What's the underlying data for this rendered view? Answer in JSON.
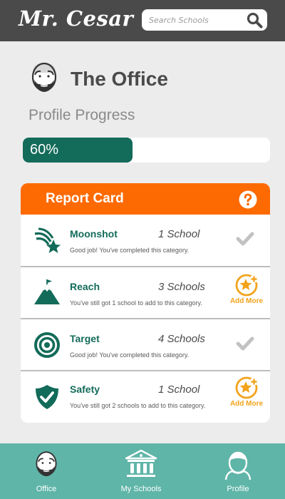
{
  "header": {
    "logo": "Mr. Cesar",
    "search_placeholder": "Search Schools",
    "search_value": ""
  },
  "profile": {
    "name": "The Office",
    "progress_label": "Profile Progress",
    "progress_percent": 60,
    "progress_text": "60%"
  },
  "report_card": {
    "title": "Report Card",
    "help_icon": "question-circle-icon",
    "rows": [
      {
        "title": "Moonshot",
        "count": "1 School",
        "description": "Good job! You've completed this category.",
        "icon": "shooting-star-icon",
        "status": "complete"
      },
      {
        "title": "Reach",
        "count": "3 Schools",
        "description": "You've still got 1 school to add to this category.",
        "icon": "mountain-peak-icon",
        "status": "incomplete",
        "action_label": "Add More"
      },
      {
        "title": "Target",
        "count": "4 Schools",
        "description": "Good job! You've completed this category.",
        "icon": "target-icon",
        "status": "complete"
      },
      {
        "title": "Safety",
        "count": "1 School",
        "description": "You've still got 2 schools to add to this category.",
        "icon": "shield-check-icon",
        "status": "incomplete",
        "action_label": "Add More"
      }
    ]
  },
  "bottom_nav": {
    "items": [
      {
        "label": "Office",
        "icon": "avatar-face-icon"
      },
      {
        "label": "My Schools",
        "icon": "school-building-icon"
      },
      {
        "label": "Profile",
        "icon": "person-outline-icon"
      }
    ]
  },
  "colors": {
    "header_bg": "#4a4a4a",
    "page_bg": "#ececec",
    "accent_green": "#136b5a",
    "accent_orange": "#fd6a02",
    "add_more_gold": "#f2a31b",
    "nav_bg": "#5fb5a8"
  }
}
